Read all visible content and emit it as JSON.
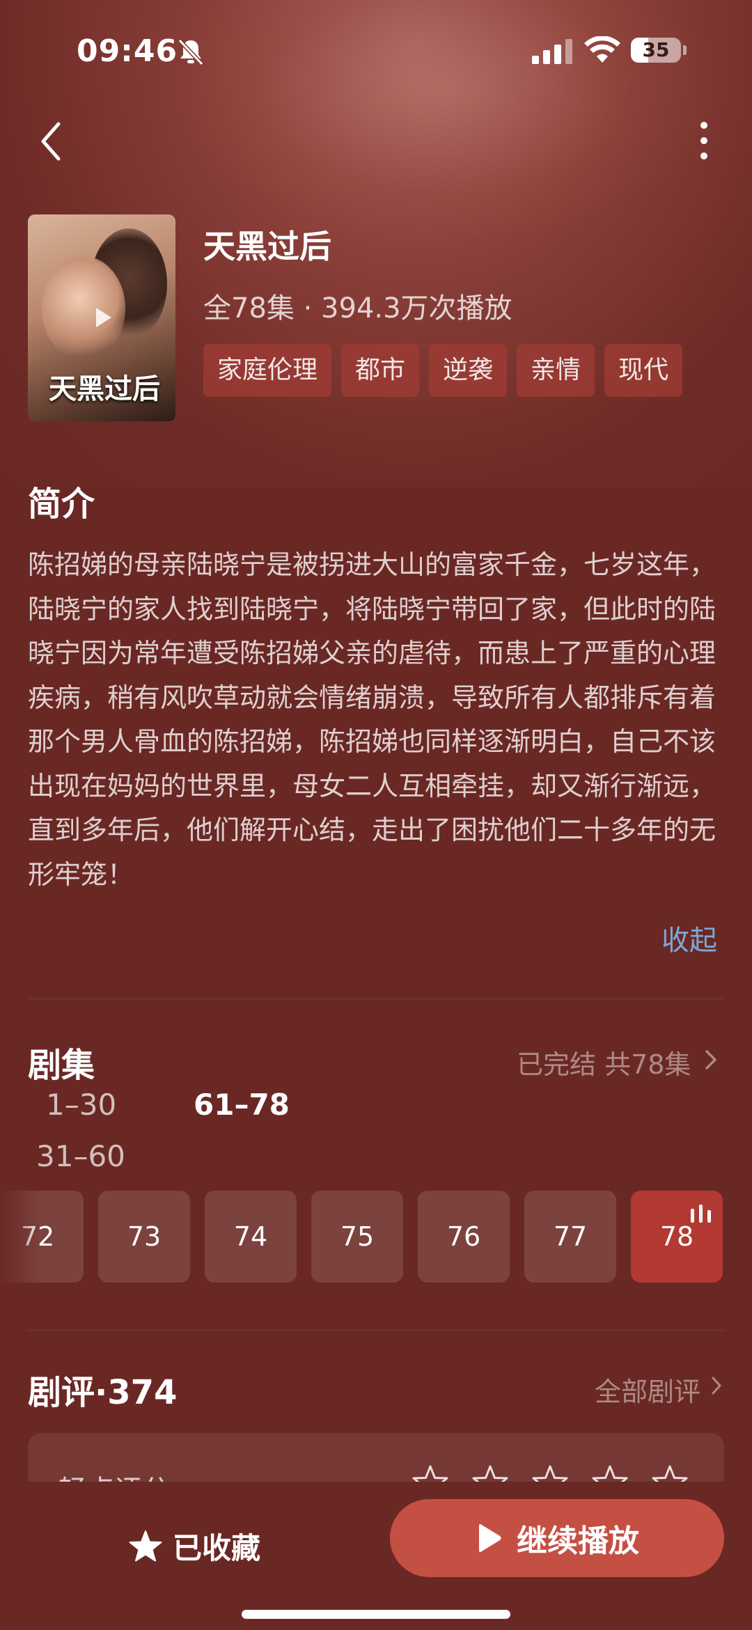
{
  "status_bar": {
    "time": "09:46",
    "battery": "35",
    "battery_level": 0.35
  },
  "drama": {
    "title": "天黑过后",
    "meta": "全78集 · 394.3万次播放",
    "poster_title": "天黑过后",
    "tags": [
      "家庭伦理",
      "都市",
      "逆袭",
      "亲情",
      "现代"
    ]
  },
  "synopsis": {
    "title": "简介",
    "text": "陈招娣的母亲陆晓宁是被拐进大山的富家千金，七岁这年，陆晓宁的家人找到陆晓宁，将陆晓宁带回了家，但此时的陆晓宁因为常年遭受陈招娣父亲的虐待，而患上了严重的心理疾病，稍有风吹草动就会情绪崩溃，导致所有人都排斥有着那个男人骨血的陈招娣，陈招娣也同样逐渐明白，自己不该出现在妈妈的世界里，母女二人互相牵挂，却又渐行渐远，直到多年后，他们解开心结，走出了困扰他们二十多年的无形牢笼！",
    "collapse_label": "收起"
  },
  "episodes": {
    "title": "剧集",
    "status": "已完结 共78集",
    "ranges": [
      "1–30",
      "31–60",
      "61–78"
    ],
    "active_range": "61–78",
    "items": [
      "72",
      "73",
      "74",
      "75",
      "76",
      "77",
      "78"
    ],
    "current": "78"
  },
  "reviews": {
    "title": "剧评·374",
    "all_label": "全部剧评",
    "rate_label": "轻点评分",
    "star_count": 5
  },
  "bottom_bar": {
    "favorite_label": "已收藏",
    "play_label": "继续播放"
  },
  "colors": {
    "background": "#6a2824",
    "accent": "#c44f43",
    "current_episode": "#b23a32",
    "link": "#7ea6d8"
  }
}
